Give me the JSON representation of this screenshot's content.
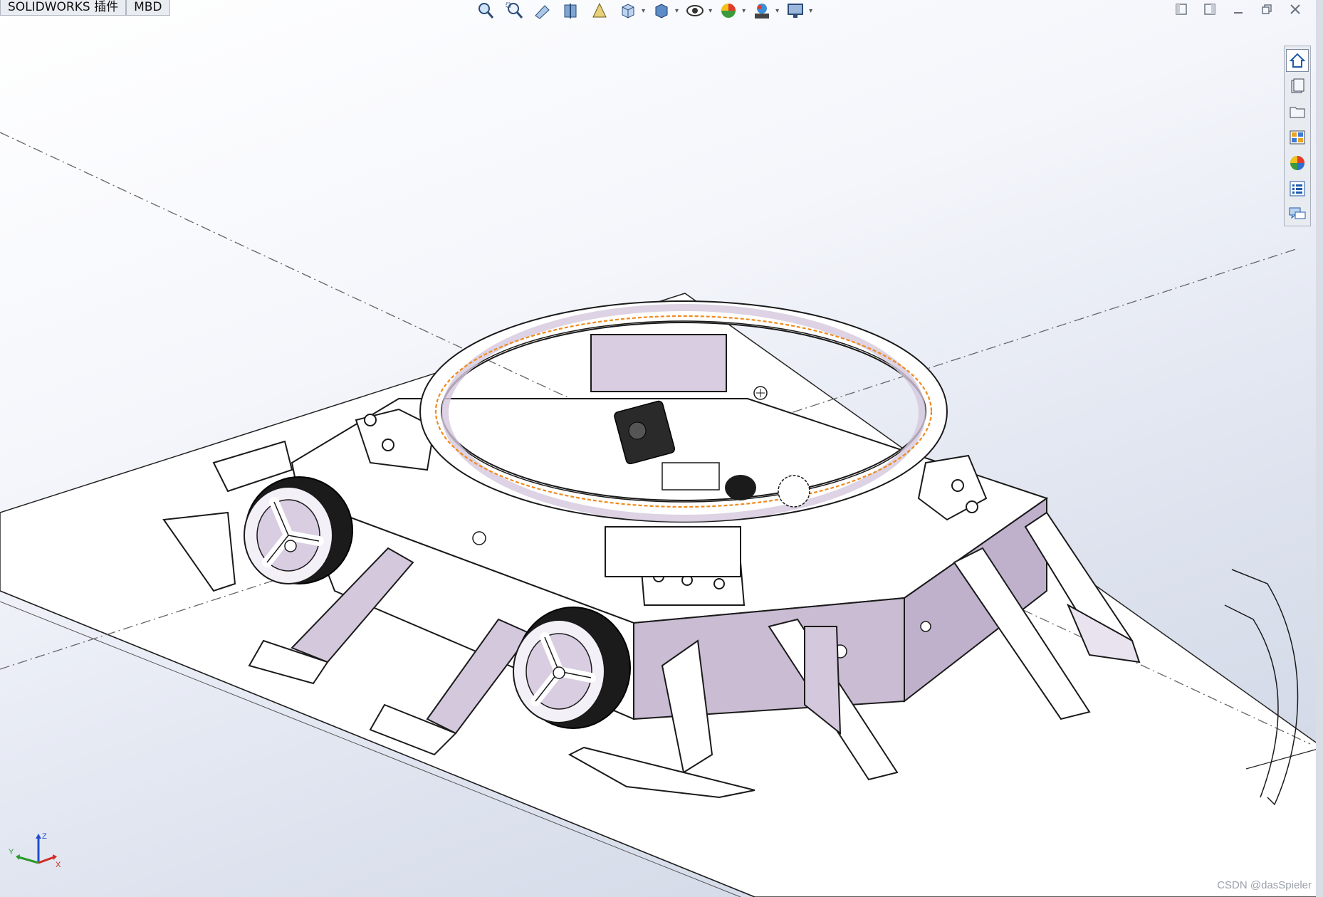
{
  "command_tabs": [
    "SOLIDWORKS 插件",
    "MBD"
  ],
  "view_toolbar": {
    "buttons": [
      {
        "icon": "zoom-to-fit-icon",
        "caret": false
      },
      {
        "icon": "zoom-to-area-icon",
        "caret": false
      },
      {
        "icon": "previous-view-icon",
        "caret": false
      },
      {
        "icon": "section-view-icon",
        "caret": false
      },
      {
        "icon": "dynamic-annotation-views-icon",
        "caret": false
      },
      {
        "icon": "view-orientation-icon",
        "caret": true
      },
      {
        "icon": "display-style-icon",
        "caret": true
      },
      {
        "icon": "hide-show-items-icon",
        "caret": true
      },
      {
        "icon": "edit-appearance-icon",
        "caret": true
      },
      {
        "icon": "apply-scene-icon",
        "caret": true
      },
      {
        "icon": "view-settings-icon",
        "caret": true
      }
    ]
  },
  "window_controls": [
    "tile-left-icon",
    "tile-right-icon",
    "minimize-icon",
    "restore-icon",
    "close-icon"
  ],
  "task_pane": [
    "solidworks-resources-icon",
    "design-library-icon",
    "file-explorer-icon",
    "view-palette-icon",
    "appearances-scenes-icon",
    "custom-properties-icon",
    "solidworks-forum-icon"
  ],
  "triad_axes": {
    "z": "Z",
    "y": "Y",
    "x": "X"
  },
  "watermark": "CSDN @dasSpieler",
  "colors": {
    "part_edge": "#1a1a1a",
    "part_face": "#ffffff",
    "shade_purple": "#c9bcd3",
    "selection_orange": "#f08a1c",
    "tire_black": "#1b1b1b"
  }
}
